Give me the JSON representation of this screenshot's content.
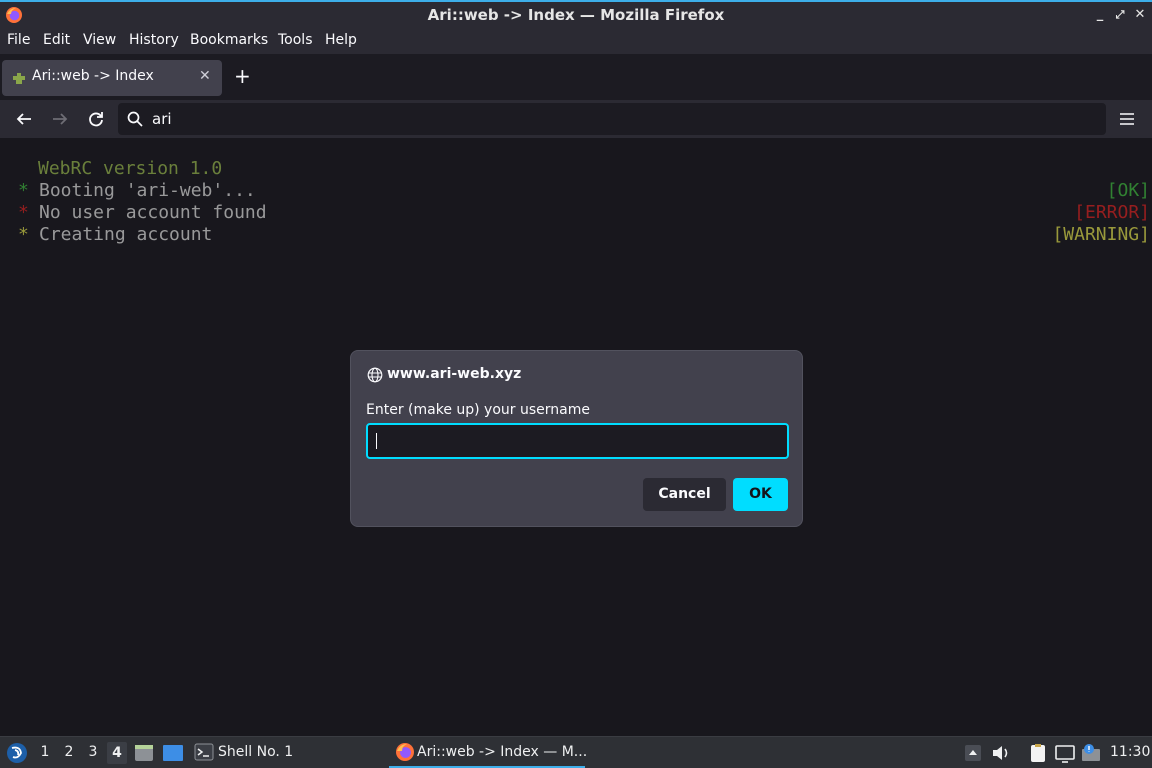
{
  "window": {
    "title": "Ari::web -> Index — Mozilla Firefox"
  },
  "menubar": {
    "items": [
      "File",
      "Edit",
      "View",
      "History",
      "Bookmarks",
      "Tools",
      "Help"
    ]
  },
  "tabs": [
    {
      "label": "Ari::web -> Index"
    }
  ],
  "urlbar": {
    "value": "ari"
  },
  "terminal": {
    "version_line": "WebRC version 1.0",
    "lines": [
      {
        "bullet": "*",
        "message": "Booting 'ari-web'...",
        "status": "[OK]",
        "color": "#3ea83e"
      },
      {
        "bullet": "*",
        "message": "No user account found",
        "status": "[ERROR]",
        "color": "#c42424"
      },
      {
        "bullet": "*",
        "message": "Creating account",
        "status": "[WARNING]",
        "color": "#c8c84a"
      }
    ]
  },
  "dialog": {
    "host": "www.ari-web.xyz",
    "prompt": "Enter (make up) your username",
    "value": "",
    "cancel_label": "Cancel",
    "ok_label": "OK"
  },
  "taskbar": {
    "workspaces": [
      "1",
      "2",
      "3",
      "4"
    ],
    "active_workspace": "4",
    "tasks": [
      {
        "label": "Shell No. 1",
        "icon": "terminal-icon"
      },
      {
        "label": "Ari::web -> Index — M...",
        "icon": "firefox-icon"
      }
    ],
    "clock": "11:30"
  },
  "colors": {
    "accent": "#00ddff",
    "version_green": "#8aa64a"
  }
}
